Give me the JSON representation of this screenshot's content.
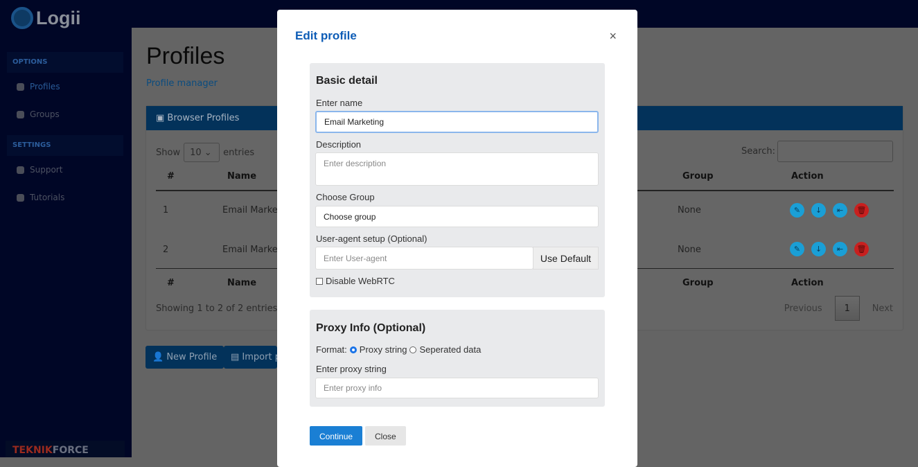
{
  "app": {
    "logo_text": "Logii",
    "footer_brand_a": "TEKNIK",
    "footer_brand_b": "FORCE"
  },
  "sidebar": {
    "sections": [
      {
        "label": "OPTIONS",
        "items": [
          {
            "label": "Profiles",
            "icon": "user-icon",
            "active": true
          },
          {
            "label": "Groups",
            "icon": "users-icon"
          }
        ]
      },
      {
        "label": "SETTINGS",
        "items": [
          {
            "label": "Support",
            "icon": "support-icon"
          },
          {
            "label": "Tutorials",
            "icon": "map-icon"
          }
        ]
      }
    ]
  },
  "page": {
    "title": "Profiles",
    "subtitle": "Profile manager",
    "card_title": "Browser Profiles",
    "show_label": "Show",
    "show_value": "10",
    "entries_label": "entries",
    "search_label": "Search:",
    "columns": [
      "#",
      "Name",
      "Group",
      "Action"
    ],
    "rows": [
      {
        "num": "1",
        "name": "Email Market",
        "group": "None"
      },
      {
        "num": "2",
        "name": "Email Market",
        "group": "None"
      }
    ],
    "info": "Showing 1 to 2 of 2 entries",
    "prev": "Previous",
    "page": "1",
    "next": "Next",
    "new_profile": "New Profile",
    "import": "Import p"
  },
  "modal": {
    "title": "Edit profile",
    "close_icon": "×",
    "basic": {
      "heading": "Basic detail",
      "name_label": "Enter name",
      "name_value": "Email Marketing",
      "desc_label": "Description",
      "desc_placeholder": "Enter description",
      "group_label": "Choose Group",
      "group_value": "Choose group",
      "ua_label": "User-agent setup (Optional)",
      "ua_placeholder": "Enter User-agent",
      "ua_button": "Use Default",
      "webrtc_label": "Disable WebRTC"
    },
    "proxy": {
      "heading": "Proxy Info (Optional)",
      "format_label": "Format:",
      "opt1": "Proxy string",
      "opt2": "Seperated data",
      "string_label": "Enter proxy string",
      "string_placeholder": "Enter proxy info"
    },
    "continue": "Continue",
    "close": "Close"
  },
  "colors": {
    "accent": "#0a7ed4",
    "danger": "#e0252b",
    "modal_title": "#0d5cb6"
  }
}
